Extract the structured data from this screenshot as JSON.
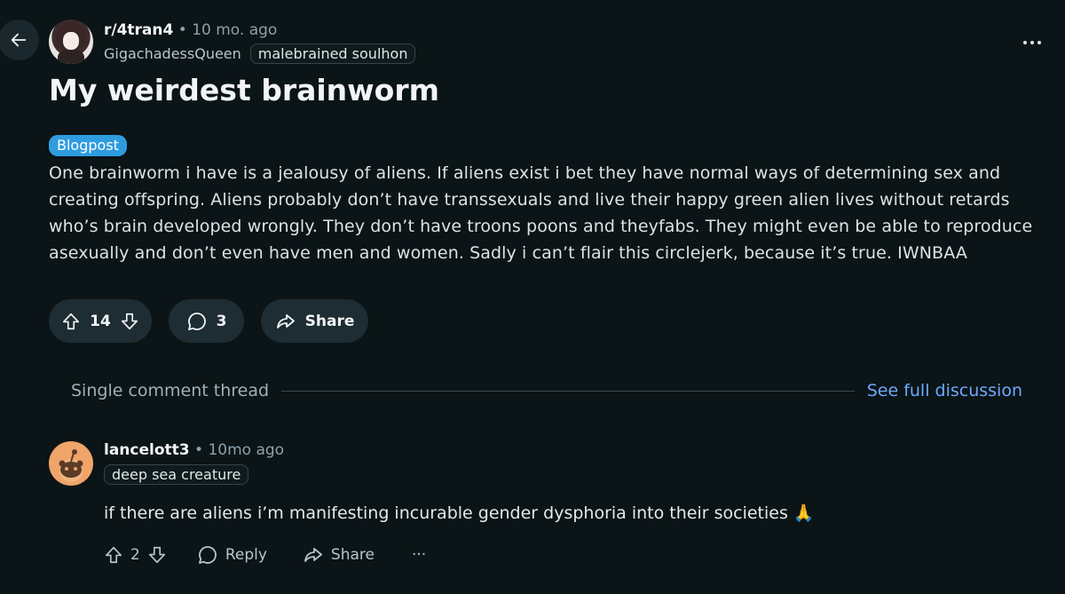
{
  "post": {
    "subreddit": "r/4tran4",
    "separator": "•",
    "age": "10 mo. ago",
    "author": "GigachadessQueen",
    "author_flair": "malebrained soulhon",
    "title": "My weirdest brainworm",
    "tag": "Blogpost",
    "body": "One brainworm i have is a jealousy of aliens. If aliens exist i bet they have normal ways of determining sex and creating offspring. Aliens probably don’t have transsexuals and live their happy green alien lives without retards who’s brain developed wrongly. They don’t have troons poons and theyfabs. They might even be able to reproduce asexually and don’t even have men and women. Sadly i can’t flair this circlejerk, because it’s true. IWNBAA",
    "score": "14",
    "comment_count": "3",
    "share_label": "Share"
  },
  "thread": {
    "label": "Single comment thread",
    "link": "See full discussion"
  },
  "comment": {
    "author": "lancelott3",
    "separator": "•",
    "age": "10mo ago",
    "flair": "deep sea creature",
    "text": "if there are aliens i’m manifesting incurable gender dysphoria into their societies 🙏",
    "score": "2",
    "reply_label": "Reply",
    "share_label": "Share",
    "more_label": "···"
  },
  "icons": {
    "back": "arrow-left-icon",
    "more": "ellipsis-icon",
    "upvote": "arrow-up-icon",
    "downvote": "arrow-down-icon",
    "comment": "speech-bubble-icon",
    "share": "share-arrow-icon",
    "reply": "speech-bubble-icon"
  },
  "colors": {
    "background": "#0b1416",
    "pill": "#1e2d33",
    "tag": "#2f9ce0",
    "link": "#6ea8ff",
    "muted": "#8ba2ad"
  }
}
